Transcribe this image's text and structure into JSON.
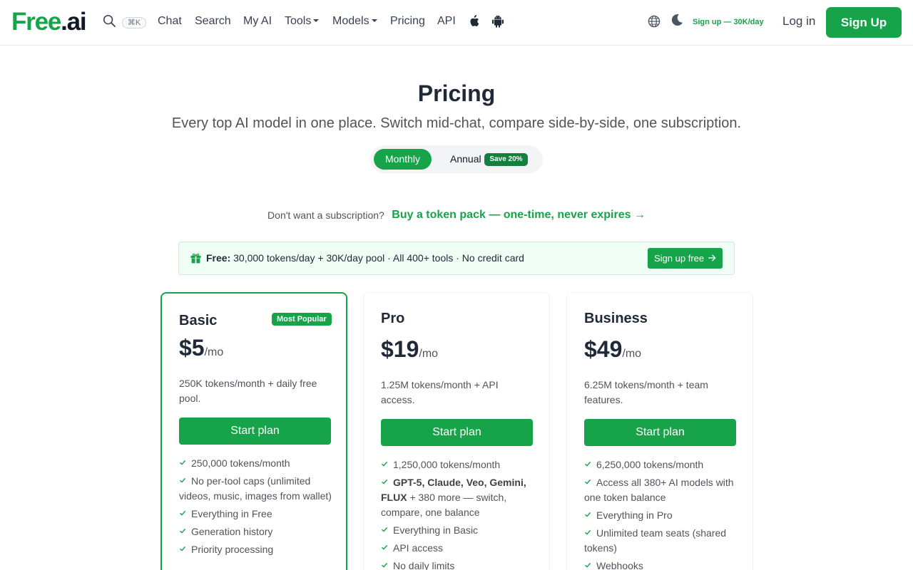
{
  "brand": {
    "part1": "Free",
    "part2": ".ai",
    "accent": "#16a34a"
  },
  "nav": {
    "shortcut": "⌘K",
    "links": [
      "Chat",
      "Search",
      "My AI",
      "Tools",
      "Models",
      "Pricing",
      "API"
    ],
    "signup_note": "Sign up — 30K/day",
    "login": "Log in",
    "signup": "Sign Up",
    "icons": [
      "search-icon",
      "apple-icon",
      "android-icon",
      "globe-icon",
      "moon-icon"
    ]
  },
  "hero": {
    "title": "Pricing",
    "subtitle": "Every top AI model in one place. Switch mid-chat, compare side-by-side, one subscription.",
    "toggle": {
      "monthly": "Monthly",
      "annual": "Annual",
      "save_badge": "Save 20%",
      "selected": "Monthly"
    }
  },
  "token_pack": {
    "question": "Don't want a subscription?",
    "link": "Buy a token pack — one-time, never expires",
    "arrow": "→"
  },
  "free_bar": {
    "label": "Free:",
    "text": "30,000 tokens/day + 30K/day pool · All 400+ tools · No credit card",
    "button": "Sign up free"
  },
  "plans": [
    {
      "name": "Basic",
      "badge": "Most Popular",
      "price": "$5",
      "per": "/mo",
      "desc": "250K tokens/month + daily free pool.",
      "cta": "Start plan",
      "features": [
        {
          "text": "250,000 tokens/month"
        },
        {
          "text": "No per-tool caps (unlimited videos, music, images from wallet)"
        },
        {
          "text": "Everything in Free"
        },
        {
          "text": "Generation history"
        },
        {
          "text": "Priority processing"
        }
      ]
    },
    {
      "name": "Pro",
      "price": "$19",
      "per": "/mo",
      "desc": "1.25M tokens/month + API access.",
      "cta": "Start plan",
      "features": [
        {
          "text": "1,250,000 tokens/month"
        },
        {
          "bold": "GPT-5, Claude, Veo, Gemini, FLUX",
          "text": " + 380 more — switch, compare, one balance"
        },
        {
          "text": "Everything in Basic"
        },
        {
          "text": "API access"
        },
        {
          "text": "No daily limits"
        }
      ]
    },
    {
      "name": "Business",
      "price": "$49",
      "per": "/mo",
      "desc": "6.25M tokens/month + team features.",
      "cta": "Start plan",
      "features": [
        {
          "text": "6,250,000 tokens/month"
        },
        {
          "text": "Access all 380+ AI models with one token balance"
        },
        {
          "text": "Everything in Pro"
        },
        {
          "text": "Unlimited team seats (shared tokens)"
        },
        {
          "text": "Webhooks"
        }
      ]
    }
  ]
}
